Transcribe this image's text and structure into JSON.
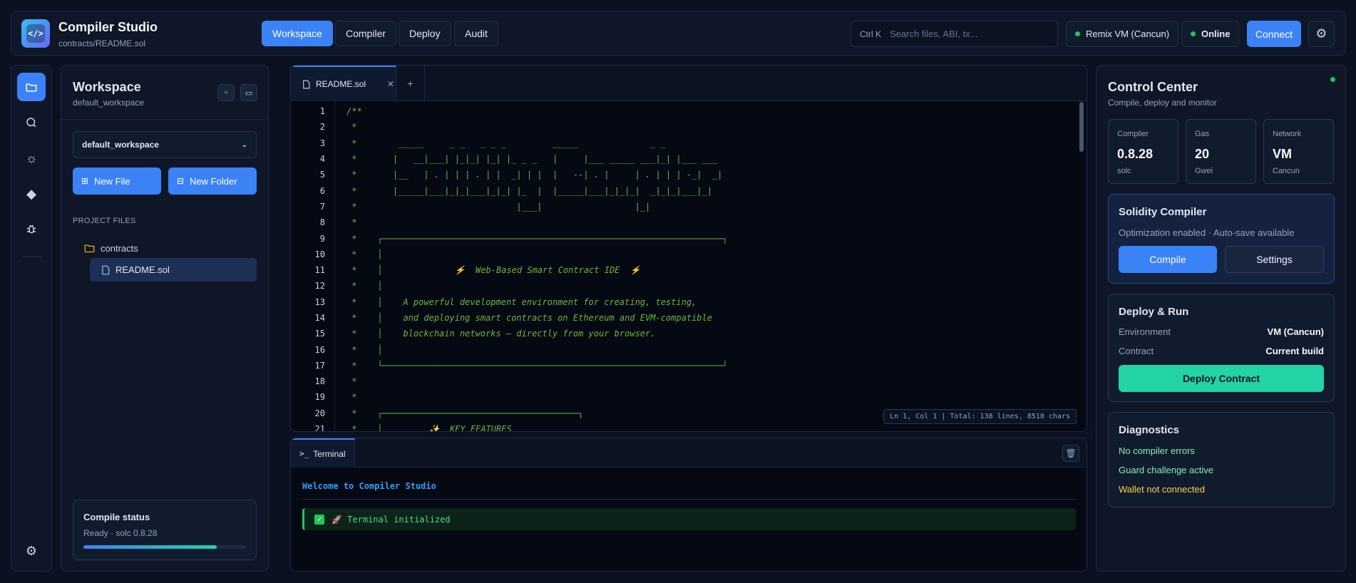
{
  "header": {
    "app_title": "Compiler Studio",
    "app_subtitle": "contracts/README.sol",
    "nav_tabs": [
      {
        "label": "Workspace"
      },
      {
        "label": "Compiler"
      },
      {
        "label": "Deploy"
      },
      {
        "label": "Audit"
      }
    ],
    "search_shortcut": "Ctrl K",
    "search_placeholder": "Search files, ABI, tx...",
    "environment": "Remix VM (Cancun)",
    "network_status": "Online",
    "connect_label": "Connect"
  },
  "sidebar": {
    "title": "Workspace",
    "subtitle": "default_workspace",
    "workspace_select": "default_workspace",
    "new_file_label": "New File",
    "new_folder_label": "New Folder",
    "section_label": "PROJECT FILES",
    "folder": "contracts",
    "file": "README.sol",
    "status_title": "Compile status",
    "status_text": "Ready · solc 0.8.28",
    "progress_percent": 82
  },
  "editor": {
    "tab_label": "README.sol",
    "lines": [
      {
        "n": "1",
        "t": "/**"
      },
      {
        "n": "2",
        "t": " *"
      },
      {
        "n": "3",
        "t": " *        _____     _ _   _ _ _         _____              _ _"
      },
      {
        "n": "4",
        "t": " *       |   __|___| |_|_| |_| |_ _ _   |     |___ _____ ___|_| |___ ___"
      },
      {
        "n": "5",
        "t": " *       |__   | . | | | . | |  _| | |  |   --| . |     | . | | | -_|  _|"
      },
      {
        "n": "6",
        "t": " *       |_____|___|_|_|___|_|_| |_  |  |_____|___|_|_|_|  _|_|_|___|_|"
      },
      {
        "n": "7",
        "t": " *                               |___|                  |_|"
      },
      {
        "n": "8",
        "t": " *"
      },
      {
        "n": "9",
        "t": " *    ┌──────────────────────────────────────────────────────────────────┐"
      },
      {
        "n": "10",
        "t": " *    │"
      },
      {
        "n": "11",
        "t": " *    │              ⚡  Web-Based Smart Contract IDE  ⚡"
      },
      {
        "n": "12",
        "t": " *    │"
      },
      {
        "n": "13",
        "t": " *    │    A powerful development environment for creating, testing,"
      },
      {
        "n": "14",
        "t": " *    │    and deploying smart contracts on Ethereum and EVM-compatible"
      },
      {
        "n": "15",
        "t": " *    │    blockchain networks — directly from your browser."
      },
      {
        "n": "16",
        "t": " *    │"
      },
      {
        "n": "17",
        "t": " *    └──────────────────────────────────────────────────────────────────┘"
      },
      {
        "n": "18",
        "t": " *"
      },
      {
        "n": "19",
        "t": " *"
      },
      {
        "n": "20",
        "t": " *    ┌──────────────────────────────────────┐"
      },
      {
        "n": "21",
        "t": " *    │         ✨  KEY FEATURES"
      }
    ],
    "cursor_status": "Ln 1, Col 1 | Total: 138 lines, 8510 chars"
  },
  "terminal": {
    "tab_label": "Terminal",
    "welcome": "Welcome to Compiler Studio",
    "message": "🚀  Terminal initialized"
  },
  "control": {
    "title": "Control Center",
    "subtitle": "Compile, deploy and monitor",
    "stats": [
      {
        "label": "Compiler",
        "value": "0.8.28",
        "unit": "solc"
      },
      {
        "label": "Gas",
        "value": "20",
        "unit": "Gwei"
      },
      {
        "label": "Network",
        "value": "VM",
        "unit": "Cancun"
      }
    ],
    "solidity_title": "Solidity Compiler",
    "solidity_sub": "Optimization enabled · Auto-save available",
    "compile_label": "Compile",
    "settings_label": "Settings",
    "deploy_title": "Deploy & Run",
    "env_label": "Environment",
    "env_value": "VM (Cancun)",
    "contract_label": "Contract",
    "contract_value": "Current build",
    "deploy_button": "Deploy Contract",
    "diag_title": "Diagnostics",
    "diagnostics": [
      {
        "text": "No compiler errors",
        "color": "#86efac"
      },
      {
        "text": "Guard challenge active",
        "color": "#86efac"
      },
      {
        "text": "Wallet not connected",
        "color": "#fcd34d"
      }
    ]
  },
  "colors": {
    "accent": "#3b82f6",
    "success": "#22c55e",
    "deploy": "#22d3a5",
    "warning": "#fcd34d"
  }
}
